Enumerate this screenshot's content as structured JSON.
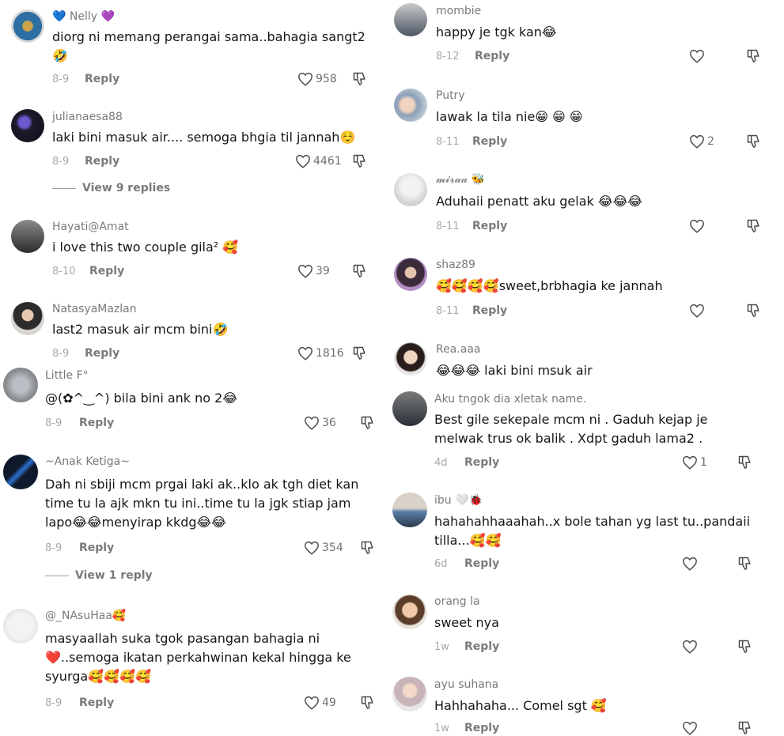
{
  "left": [
    {
      "user": "💙 Nelly 💜",
      "text": "diorg ni memang perangai sama..bahagia sangt2 🤣",
      "date": "8-9",
      "reply": "Reply",
      "likes": "958"
    },
    {
      "user": "julianaesa88",
      "text": "laki bini masuk air.... semoga bhgia til jannah☺️",
      "date": "8-9",
      "reply": "Reply",
      "likes": "4461",
      "view_replies": "View 9 replies"
    },
    {
      "user": "Hayati@Amat",
      "text": "i love this two couple gila² 🥰",
      "date": "8-10",
      "reply": "Reply",
      "likes": "39"
    },
    {
      "user": "NatasyaMazlan",
      "text": "last2 masuk air mcm bini🤣",
      "date": "8-9",
      "reply": "Reply",
      "likes": "1816"
    },
    {
      "user": "Little F°",
      "text": "@(✿^‿^) bila bini ank no 2😂",
      "date": "8-9",
      "reply": "Reply",
      "likes": "36"
    },
    {
      "user": "~Anak Ketiga~",
      "text": "Dah ni sbiji mcm prgai laki ak..klo ak tgh diet kan time tu la ajk mkn tu ini..time tu la jgk stiap jam lapo😂😂menyirap kkdg😂😂",
      "date": "8-9",
      "reply": "Reply",
      "likes": "354",
      "view_replies": "View 1 reply"
    },
    {
      "user": "@_NAsuHaa🥰",
      "text": "masyaallah suka tgok pasangan bahagia ni ❤️..semoga ikatan perkahwinan kekal hingga ke syurga🥰🥰🥰🥰",
      "date": "8-9",
      "reply": "Reply",
      "likes": "49"
    }
  ],
  "right": [
    {
      "user": "mombie",
      "text": "happy je tgk kan😂",
      "date": "8-12",
      "reply": "Reply",
      "likes": ""
    },
    {
      "user": "Putry",
      "text": "lawak la tila nie😁 😁 😁",
      "date": "8-11",
      "reply": "Reply",
      "likes": "2"
    },
    {
      "user": "𝓶𝓲𝓻𝓪𝓪 🐝",
      "text": "Aduhaii penatt aku gelak 😂😂😂",
      "date": "8-11",
      "reply": "Reply",
      "likes": ""
    },
    {
      "user": "shaz89",
      "text": "🥰🥰🥰🥰sweet,brbhagia ke jannah",
      "date": "8-11",
      "reply": "Reply",
      "likes": ""
    },
    {
      "user": "Rea.aaa",
      "text": "😂😂😂 laki bini msuk air",
      "date": "",
      "reply": "",
      "likes": ""
    },
    {
      "user": "Aku tngok dia xletak name.",
      "text": "Best gile sekepale mcm ni . Gaduh kejap je melwak trus ok balik . Xdpt gaduh lama2 .",
      "date": "4d",
      "reply": "Reply",
      "likes": "1"
    },
    {
      "user": "ibu 🤍🐞",
      "text": "hahahahhaaahah..x bole tahan yg last tu..pandaii tilla...🥰🥰",
      "date": "6d",
      "reply": "Reply",
      "likes": ""
    },
    {
      "user": "orang la",
      "text": "sweet nya",
      "date": "1w",
      "reply": "Reply",
      "likes": ""
    },
    {
      "user": "ayu suhana",
      "text": "Hahhahaha... Comel sgt 🥰",
      "date": "1w",
      "reply": "Reply",
      "likes": ""
    }
  ],
  "icons": {
    "like": "heart-outline-icon",
    "dislike": "thumb-down-outline-icon"
  },
  "colors": {
    "username": "#7a7a7a",
    "text": "#161616",
    "date": "#a8a8a8",
    "background": "#ffffff"
  }
}
